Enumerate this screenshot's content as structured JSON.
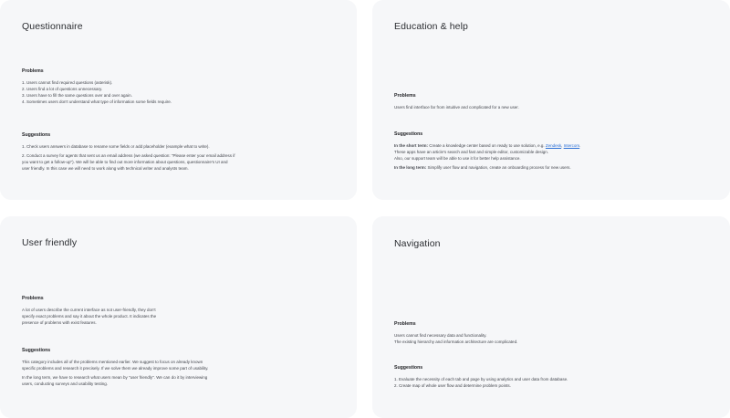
{
  "questionnaire": {
    "title": "Questionnaire",
    "problems_heading": "Problems",
    "problems": [
      "1. Users cannot find required questions (asterisk).",
      "2. Users find a lot of questions unnecessary.",
      "3. Users have to fill the same questions over and over again.",
      "4. Sometimes users don't understand what type of information some fields require."
    ],
    "suggestions_heading": "Suggestions",
    "suggestions": [
      "1. Check users answers in database to rename some fields or add placeholder (example what to write).",
      "2. Conduct a survey for agents that sent us an email address (we asked question: \"Please enter your email address if",
      "you want to get a follow-up\"). We will be able to find out more information about questions, questionnaire's UI and",
      "user friendly. In this case we will need to work along with technical writer and analysts team."
    ]
  },
  "education": {
    "title": "Education & help",
    "problems_heading": "Problems",
    "problems": [
      "Users find interface far from intuitive and complicated for a new user."
    ],
    "suggestions_heading": "Suggestions",
    "short_term_label": "In the short term:",
    "short_term_text": " Create a knowledge center based on ready to use solution, e.g. ",
    "link_1": "Zendesk",
    "link_sep": ", ",
    "link_2": "Intercom",
    "short_term_end": ".",
    "short_term_lines": [
      "These apps have an article's search and fast and simple editor, customizable design.",
      "Also, our support team will be able to use it for better help assistance."
    ],
    "long_term_label": "In the long term:",
    "long_term_text": " Simplify user flow and navigation, create an onboarding process for new users."
  },
  "user_friendly": {
    "title": "User friendly",
    "problems_heading": "Problems",
    "problems": [
      "A lot of users describe the current interface as not user-friendly, they don't",
      "specify exact problems and say it about the whole product. It indicates the",
      "presence of problems with exist features."
    ],
    "suggestions_heading": "Suggestions",
    "suggestions_p1": [
      "This category includes all of the problems mentioned earlier. We suggest to focus on already known",
      "specific problems and research it precisely. If we solve them we already improve some part of usability."
    ],
    "suggestions_p2": [
      "In the long term, we have to research what users mean by \"user friendly\". We can do it by interviewing",
      "users, conducting surveys and usability testing."
    ]
  },
  "navigation": {
    "title": "Navigation",
    "problems_heading": "Problems",
    "problems": [
      "Users cannot find necessary data and functionality.",
      "The existing hierarchy and information architecture are complicated."
    ],
    "suggestions_heading": "Suggestions",
    "suggestions": [
      "1. Evaluate the necessity of each tab and page by using analytics and user data from database.",
      "2. Create map of whole user flow and determine problem points."
    ]
  }
}
